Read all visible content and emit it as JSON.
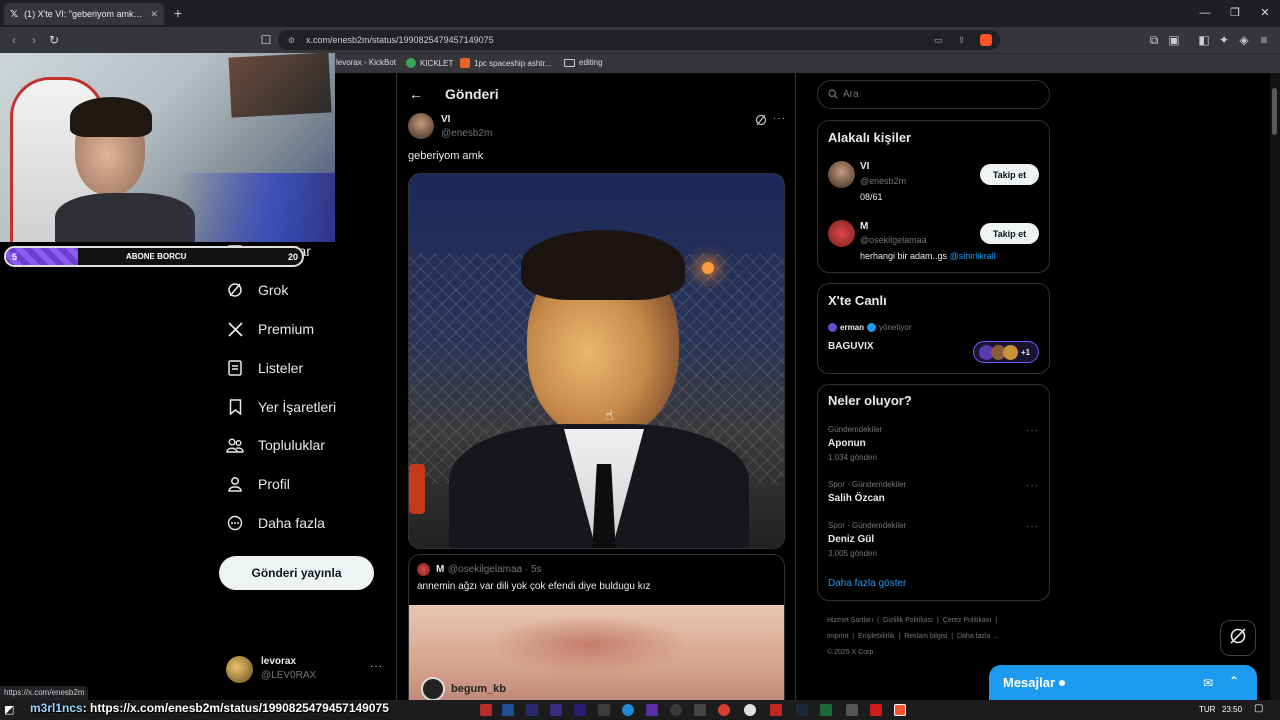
{
  "browser": {
    "tab_title": "(1) X'te VI: \"geberiyom amk http:",
    "url": "x.com/enesb2m/status/1990825479457149075",
    "bookmarks": [
      {
        "label": "levorax - KickBot"
      },
      {
        "label": "KICKLET"
      },
      {
        "label": "1pc spaceship ashtr..."
      },
      {
        "label": "editing"
      }
    ],
    "status_url": "https://x.com/enesb2m"
  },
  "sidebar": {
    "items": [
      {
        "label": "Mesajlar",
        "icon": "mail-icon"
      },
      {
        "label": "Grok",
        "icon": "grok-icon"
      },
      {
        "label": "Premium",
        "icon": "x-logo-icon"
      },
      {
        "label": "Listeler",
        "icon": "list-icon"
      },
      {
        "label": "Yer İşaretleri",
        "icon": "bookmark-icon"
      },
      {
        "label": "Topluluklar",
        "icon": "communities-icon"
      },
      {
        "label": "Profil",
        "icon": "profile-icon"
      },
      {
        "label": "Daha fazla",
        "icon": "more-icon"
      }
    ],
    "post_button": "Gönderi yayınla",
    "account": {
      "name": "levorax",
      "handle": "@LEV0RAX"
    }
  },
  "post": {
    "header_title": "Gönderi",
    "author_name": "VI",
    "author_handle": "@enesb2m",
    "text": "geberiyom amk",
    "quote": {
      "author_name": "M",
      "author_handle": "@osekilgelamaa",
      "time": "5s",
      "text": "annemin ağzı var dili yok çok efendi diye buldugu kız",
      "video_user": "begum_kb"
    }
  },
  "right": {
    "search_placeholder": "Ara",
    "related": {
      "title": "Alakalı kişiler",
      "people": [
        {
          "name": "VI",
          "handle": "@enesb2m",
          "bio": "08/61",
          "button": "Takip et"
        },
        {
          "name": "M",
          "handle": "@osekilgelamaa",
          "bio": "herhangi bir adam..gs",
          "bio_link": "@sinirlikrall",
          "button": "Takip et"
        }
      ]
    },
    "live": {
      "title": "X'te Canlı",
      "host": "erman",
      "host_role": "yönetiyor",
      "space_title": "BAGUVIX",
      "extra_count": "+1"
    },
    "trends": {
      "title": "Neler oluyor?",
      "items": [
        {
          "context": "Gündemdekiler",
          "name": "Aponun",
          "count": "1.034 gönderi"
        },
        {
          "context": "Spor · Gündemdekiler",
          "name": "Salih Özcan",
          "count": ""
        },
        {
          "context": "Spor · Gündemdekiler",
          "name": "Deniz Gül",
          "count": "3.005 gönderi"
        }
      ],
      "show_more": "Daha fazla göster"
    },
    "footer": {
      "links": [
        "Hizmet Şartları",
        "Gizlilik Politikası",
        "Çerez Politikası",
        "Imprint",
        "Erişilebilirlik",
        "Reklam bilgisi",
        "Daha fazla ..."
      ],
      "copyright": "© 2025 X Corp."
    }
  },
  "dm_dock": {
    "label": "Mesajlar"
  },
  "stream_overlay": {
    "counter": "5",
    "label": "ABONE BORCU",
    "right_value": "20",
    "chat_user": "m3rl1ncs",
    "chat_text": ": https://x.com/enesb2m/status/1990825479457149075"
  },
  "taskbar": {
    "lang": "TUR",
    "time": "23:50"
  },
  "colors": {
    "accent": "#1d9bf0",
    "bg": "#000000",
    "border": "#2f3336",
    "muted": "#71767b"
  }
}
